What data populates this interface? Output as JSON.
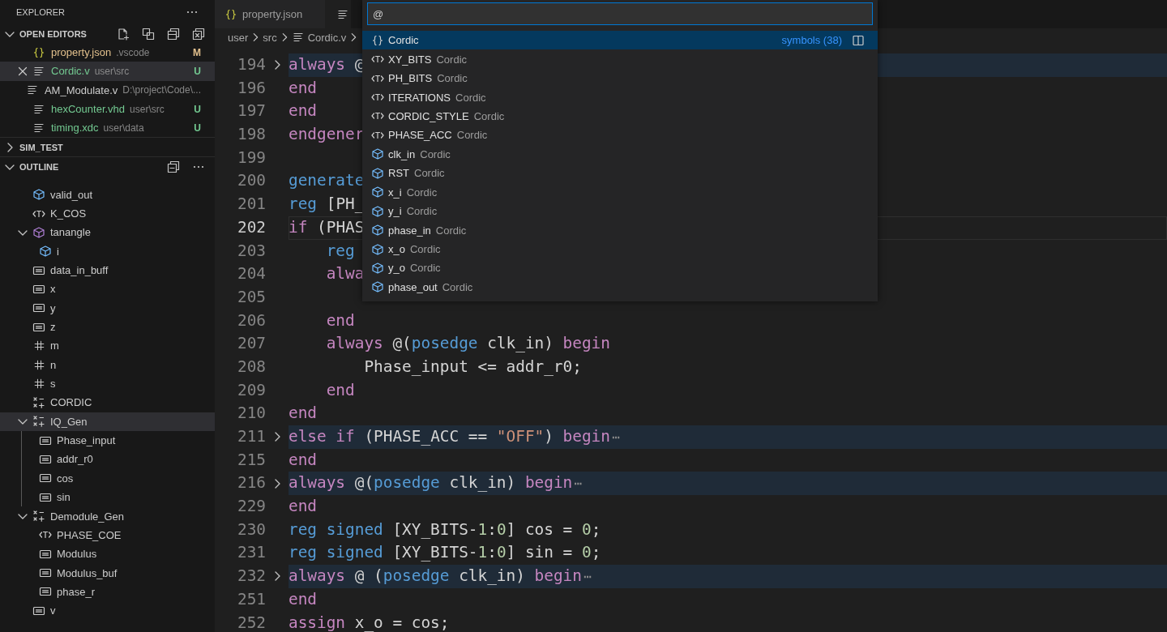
{
  "sidebar": {
    "title": "EXPLORER",
    "sections": [
      {
        "kind": "open_editors",
        "title": "OPEN EDITORS",
        "expanded": true,
        "items": [
          {
            "kind": "json",
            "name": "property.json",
            "path": ".vscode",
            "status": "M",
            "selected": false
          },
          {
            "kind": "file",
            "name": "Cordic.v",
            "path": "user\\src",
            "status": "U",
            "selected": true
          },
          {
            "kind": "file",
            "name": "AM_Modulate.v",
            "path": "D:\\project\\Code\\...",
            "selected": false
          },
          {
            "kind": "file",
            "name": "hexCounter.vhd",
            "path": "user\\src",
            "status": "U",
            "selected": false
          },
          {
            "kind": "file",
            "name": "timing.xdc",
            "path": "user\\data",
            "status": "U",
            "selected": false
          }
        ]
      },
      {
        "kind": "folder",
        "title": "SIM_TEST",
        "expanded": false
      },
      {
        "kind": "outline",
        "title": "OUTLINE",
        "expanded": true,
        "items": [
          {
            "kind": "port",
            "name": "valid_out",
            "selected": false
          },
          {
            "kind": "parameter",
            "name": "K_COS",
            "selected": false
          },
          {
            "kind": "module",
            "name": "tanangle",
            "selected": false,
            "expanded": true,
            "children": [
              {
                "kind": "port",
                "name": "i",
                "selected": false
              }
            ]
          },
          {
            "kind": "variable",
            "name": "data_in_buff",
            "selected": false
          },
          {
            "kind": "variable",
            "name": "x",
            "selected": false
          },
          {
            "kind": "variable",
            "name": "y",
            "selected": false
          },
          {
            "kind": "variable",
            "name": "z",
            "selected": false
          },
          {
            "kind": "integer",
            "name": "m",
            "selected": false
          },
          {
            "kind": "integer",
            "name": "n",
            "selected": false
          },
          {
            "kind": "integer",
            "name": "s",
            "selected": false
          },
          {
            "kind": "generate",
            "name": "CORDIC",
            "selected": false
          },
          {
            "kind": "generate",
            "name": "IQ_Gen",
            "selected": true,
            "expanded": true,
            "children": [
              {
                "kind": "variable",
                "name": "Phase_input",
                "selected": false
              },
              {
                "kind": "variable",
                "name": "addr_r0",
                "selected": false
              },
              {
                "kind": "variable",
                "name": "cos",
                "selected": false
              },
              {
                "kind": "variable",
                "name": "sin",
                "selected": false
              }
            ]
          },
          {
            "kind": "generate",
            "name": "Demodule_Gen",
            "selected": false,
            "expanded": true,
            "children": [
              {
                "kind": "parameter",
                "name": "PHASE_COE",
                "selected": false
              },
              {
                "kind": "variable",
                "name": "Modulus",
                "selected": false
              },
              {
                "kind": "variable",
                "name": "Modulus_buf",
                "selected": false
              },
              {
                "kind": "variable",
                "name": "phase_r",
                "selected": false
              }
            ]
          },
          {
            "kind": "variable",
            "name": "v",
            "selected": false
          }
        ]
      }
    ]
  },
  "tabs": [
    {
      "kind": "json",
      "label": "property.json",
      "selected": false
    },
    {
      "kind": "file",
      "selected": true
    }
  ],
  "breadcrumb": [
    {
      "kind": "folder",
      "label": "user"
    },
    {
      "kind": "folder",
      "label": "src"
    },
    {
      "kind": "file",
      "label": "Cordic.v"
    }
  ],
  "editor": {
    "lines": [
      {
        "number": "194",
        "folded": true,
        "tokens": [
          {
            "kind": "control",
            "text": "always"
          },
          {
            "kind": "text",
            "text": " @"
          }
        ]
      },
      {
        "number": "196",
        "tokens": [
          {
            "kind": "control",
            "text": "end"
          }
        ]
      },
      {
        "number": "197",
        "tokens": [
          {
            "kind": "control",
            "text": "end"
          }
        ]
      },
      {
        "number": "198",
        "tokens": [
          {
            "kind": "control",
            "text": "endgener"
          }
        ]
      },
      {
        "number": "199"
      },
      {
        "number": "200",
        "tokens": [
          {
            "kind": "keyword",
            "text": "generate"
          }
        ]
      },
      {
        "number": "201",
        "tokens": [
          {
            "kind": "keyword",
            "text": "reg"
          },
          {
            "kind": "text",
            "text": " [PH_"
          }
        ]
      },
      {
        "number": "202",
        "current": true,
        "tokens": [
          {
            "kind": "control",
            "text": "if"
          },
          {
            "kind": "text",
            "text": " (PHAS"
          }
        ]
      },
      {
        "number": "203",
        "tokens": [
          {
            "kind": "keyword",
            "text": "    reg"
          }
        ]
      },
      {
        "number": "204",
        "tokens": [
          {
            "kind": "control",
            "text": "    alwa"
          }
        ]
      },
      {
        "number": "205"
      },
      {
        "number": "206",
        "tokens": [
          {
            "kind": "control",
            "text": "    end"
          }
        ]
      },
      {
        "number": "207",
        "tokens": [
          {
            "kind": "control",
            "text": "    always"
          },
          {
            "kind": "text",
            "text": " @("
          },
          {
            "kind": "keyword",
            "text": "posedge"
          },
          {
            "kind": "text",
            "text": " clk_in) "
          },
          {
            "kind": "control",
            "text": "begin"
          }
        ]
      },
      {
        "number": "208",
        "tokens": [
          {
            "kind": "text",
            "text": "        Phase_input <= addr_r0;"
          }
        ]
      },
      {
        "number": "209",
        "tokens": [
          {
            "kind": "control",
            "text": "    end"
          }
        ]
      },
      {
        "number": "210",
        "tokens": [
          {
            "kind": "control",
            "text": "end"
          }
        ]
      },
      {
        "number": "211",
        "folded": true,
        "ellipsis": "⋯",
        "tokens": [
          {
            "kind": "control",
            "text": "else if"
          },
          {
            "kind": "text",
            "text": " (PHASE_ACC == "
          },
          {
            "kind": "string",
            "text": "\"OFF\""
          },
          {
            "kind": "text",
            "text": ") "
          },
          {
            "kind": "control",
            "text": "begin"
          }
        ]
      },
      {
        "number": "215",
        "tokens": [
          {
            "kind": "control",
            "text": "end"
          }
        ]
      },
      {
        "number": "216",
        "folded": true,
        "ellipsis": "⋯",
        "tokens": [
          {
            "kind": "control",
            "text": "always"
          },
          {
            "kind": "text",
            "text": " @("
          },
          {
            "kind": "keyword",
            "text": "posedge"
          },
          {
            "kind": "text",
            "text": " clk_in) "
          },
          {
            "kind": "control",
            "text": "begin"
          }
        ]
      },
      {
        "number": "229",
        "tokens": [
          {
            "kind": "control",
            "text": "end"
          }
        ]
      },
      {
        "number": "230",
        "tokens": [
          {
            "kind": "keyword",
            "text": "reg signed"
          },
          {
            "kind": "text",
            "text": " [XY_BITS-"
          },
          {
            "kind": "number",
            "text": "1"
          },
          {
            "kind": "text",
            "text": ":"
          },
          {
            "kind": "number",
            "text": "0"
          },
          {
            "kind": "text",
            "text": "] cos = "
          },
          {
            "kind": "number",
            "text": "0"
          },
          {
            "kind": "text",
            "text": ";"
          }
        ]
      },
      {
        "number": "231",
        "tokens": [
          {
            "kind": "keyword",
            "text": "reg signed"
          },
          {
            "kind": "text",
            "text": " [XY_BITS-"
          },
          {
            "kind": "number",
            "text": "1"
          },
          {
            "kind": "text",
            "text": ":"
          },
          {
            "kind": "number",
            "text": "0"
          },
          {
            "kind": "text",
            "text": "] sin = "
          },
          {
            "kind": "number",
            "text": "0"
          },
          {
            "kind": "text",
            "text": ";"
          }
        ]
      },
      {
        "number": "232",
        "folded": true,
        "ellipsis": "⋯",
        "tokens": [
          {
            "kind": "control",
            "text": "always"
          },
          {
            "kind": "text",
            "text": " @ ("
          },
          {
            "kind": "keyword",
            "text": "posedge"
          },
          {
            "kind": "text",
            "text": " clk_in) "
          },
          {
            "kind": "control",
            "text": "begin"
          }
        ]
      },
      {
        "number": "251",
        "tokens": [
          {
            "kind": "control",
            "text": "end"
          }
        ]
      },
      {
        "number": "252",
        "tokens": [
          {
            "kind": "control",
            "text": "assign"
          },
          {
            "kind": "text",
            "text": " x_o = cos;"
          }
        ]
      }
    ]
  },
  "quick_open": {
    "value": "@",
    "items": [
      {
        "kind": "namespace",
        "name": "Cordic",
        "summary": "symbols (38)",
        "selected": true
      },
      {
        "kind": "parameter",
        "name": "XY_BITS",
        "detail": "Cordic",
        "selected": false
      },
      {
        "kind": "parameter",
        "name": "PH_BITS",
        "detail": "Cordic",
        "selected": false
      },
      {
        "kind": "parameter",
        "name": "ITERATIONS",
        "detail": "Cordic",
        "selected": false
      },
      {
        "kind": "parameter",
        "name": "CORDIC_STYLE",
        "detail": "Cordic",
        "selected": false
      },
      {
        "kind": "parameter",
        "name": "PHASE_ACC",
        "detail": "Cordic",
        "selected": false
      },
      {
        "kind": "port",
        "name": "clk_in",
        "detail": "Cordic",
        "selected": false
      },
      {
        "kind": "port",
        "name": "RST",
        "detail": "Cordic",
        "selected": false
      },
      {
        "kind": "port",
        "name": "x_i",
        "detail": "Cordic",
        "selected": false
      },
      {
        "kind": "port",
        "name": "y_i",
        "detail": "Cordic",
        "selected": false
      },
      {
        "kind": "port",
        "name": "phase_in",
        "detail": "Cordic",
        "selected": false
      },
      {
        "kind": "port",
        "name": "x_o",
        "detail": "Cordic",
        "selected": false
      },
      {
        "kind": "port",
        "name": "y_o",
        "detail": "Cordic",
        "selected": false
      },
      {
        "kind": "port",
        "name": "phase_out",
        "detail": "Cordic",
        "selected": false
      }
    ]
  }
}
